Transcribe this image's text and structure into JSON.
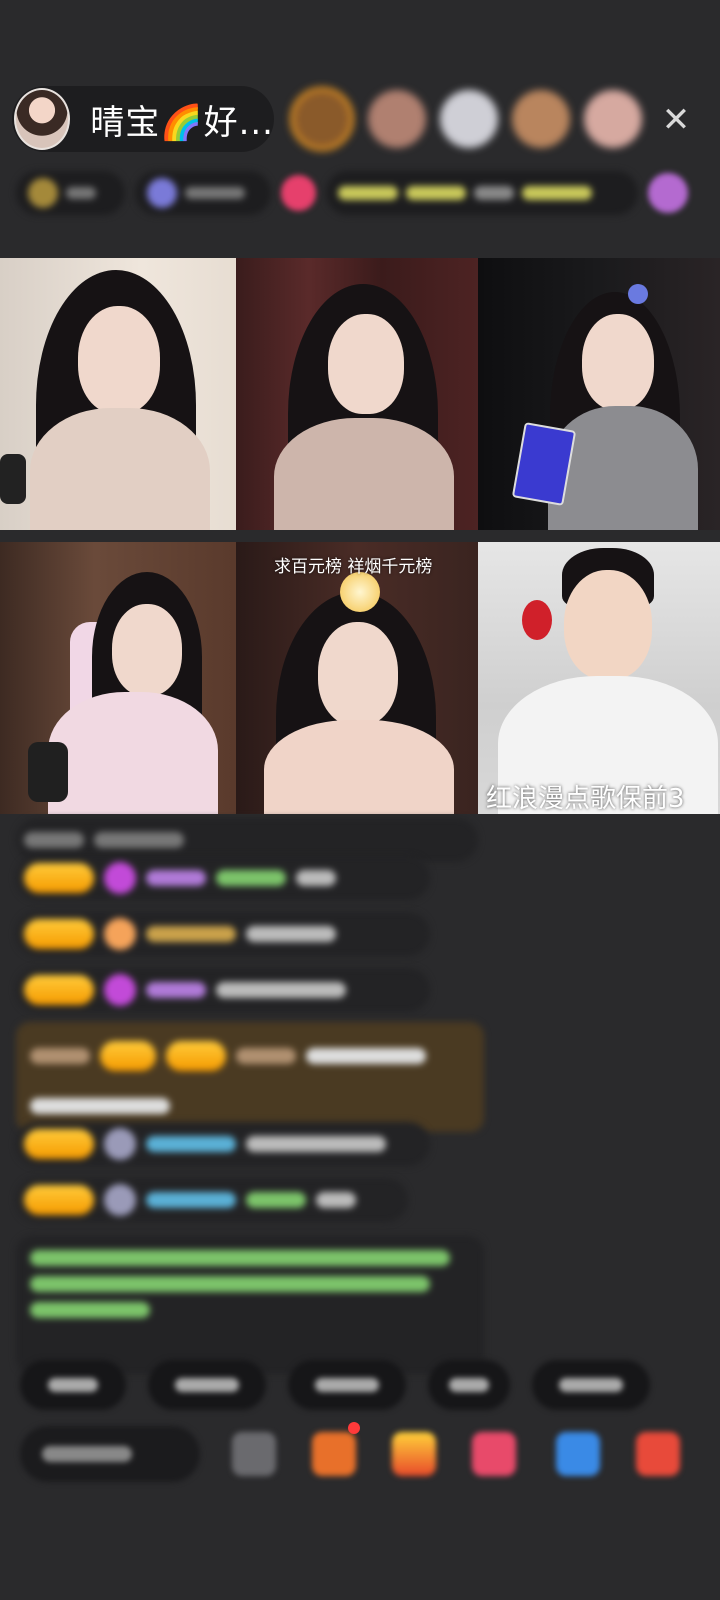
{
  "header": {
    "host_name": "晴宝🌈好...",
    "close_icon": "close-icon"
  },
  "viewers": [
    {
      "name": "viewer-1",
      "color": "#c98a3a"
    },
    {
      "name": "viewer-2",
      "color": "#b08070"
    },
    {
      "name": "viewer-3",
      "color": "#cfcfd6"
    },
    {
      "name": "viewer-4",
      "color": "#b9855e"
    },
    {
      "name": "viewer-5",
      "color": "#d6a9a0"
    }
  ],
  "tiles": [
    {
      "id": "tile-1",
      "caption": ""
    },
    {
      "id": "tile-2",
      "caption": ""
    },
    {
      "id": "tile-3",
      "caption": ""
    },
    {
      "id": "tile-4",
      "caption": ""
    },
    {
      "id": "tile-5",
      "caption": "求百元榜 祥烟千元榜"
    },
    {
      "id": "tile-6",
      "caption": "红浪漫点歌保前3"
    }
  ],
  "colors": {
    "background": "#2a2a2c",
    "badge": "#f5a300",
    "chat_green": "#7cc46a",
    "chat_blue": "#5ab0d6",
    "chat_purple": "#b07ad8"
  }
}
